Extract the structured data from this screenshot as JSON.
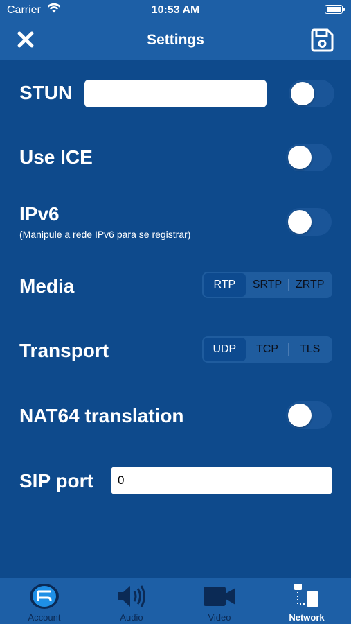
{
  "status_bar": {
    "carrier": "Carrier",
    "time": "10:53 AM"
  },
  "header": {
    "title": "Settings",
    "close_icon": "close-icon",
    "save_icon": "save-icon"
  },
  "stun": {
    "label": "STUN",
    "value": "",
    "enabled": false
  },
  "use_ice": {
    "label": "Use ICE",
    "enabled": false
  },
  "ipv6": {
    "label": "IPv6",
    "subtitle": "(Manipule a rede IPv6 para se registrar)",
    "enabled": false
  },
  "media": {
    "label": "Media",
    "options": [
      "RTP",
      "SRTP",
      "ZRTP"
    ],
    "selected": "RTP"
  },
  "transport": {
    "label": "Transport",
    "options": [
      "UDP",
      "TCP",
      "TLS"
    ],
    "selected": "UDP"
  },
  "nat64": {
    "label": "NAT64 translation",
    "enabled": false
  },
  "sip_port": {
    "label": "SIP port",
    "value": "0"
  },
  "tabs": [
    {
      "label": "Account",
      "icon": "account-icon",
      "active": false
    },
    {
      "label": "Audio",
      "icon": "speaker-icon",
      "active": false
    },
    {
      "label": "Video",
      "icon": "video-camera-icon",
      "active": false
    },
    {
      "label": "Network",
      "icon": "network-icon",
      "active": true
    }
  ],
  "colors": {
    "background": "#0e4a8c",
    "header": "#1d5fa6",
    "toggle_off": "#1a5598",
    "segment_selected": "#0d4a8f"
  }
}
